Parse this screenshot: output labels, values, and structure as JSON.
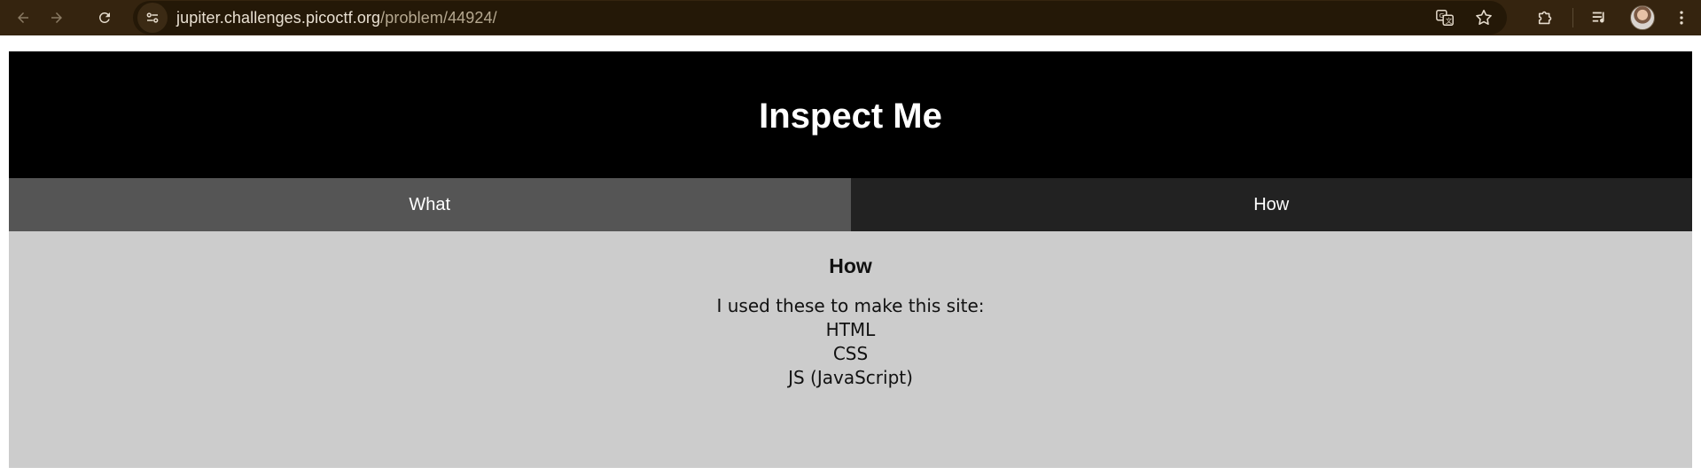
{
  "browser": {
    "url_host": "jupiter.challenges.picoctf.org",
    "url_path": "/problem/44924/",
    "icons": {
      "back": "arrow-left-icon",
      "forward": "arrow-right-icon",
      "reload": "reload-icon",
      "site_info": "tune-icon",
      "translate": "translate-icon",
      "bookmark": "star-icon",
      "extensions": "puzzle-icon",
      "media": "queue-music-icon",
      "profile": "avatar",
      "menu": "kebab-menu-icon"
    }
  },
  "site": {
    "title": "Inspect Me",
    "tabs": [
      {
        "label": "What"
      },
      {
        "label": "How"
      }
    ],
    "section": {
      "heading": "How",
      "intro": "I used these to make this site:",
      "items": [
        "HTML",
        "CSS",
        "JS (JavaScript)"
      ]
    }
  },
  "colors": {
    "chrome": "#35240f",
    "header": "#000000",
    "tab_what": "#555555",
    "tab_how": "#222222",
    "content": "#cccccc"
  }
}
